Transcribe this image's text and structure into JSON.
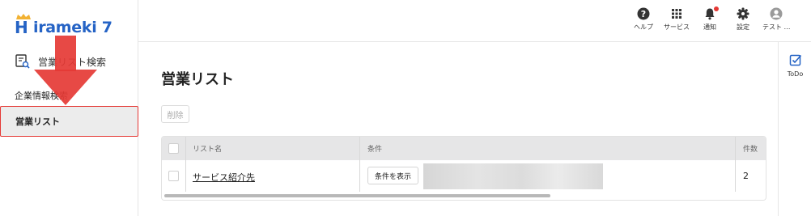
{
  "brand": {
    "logo_text": "irameki 7",
    "logo_letter": "H",
    "color": "#2563c5"
  },
  "sidebar": {
    "search_label": "営業リスト検索",
    "items": [
      {
        "label": "企業情報検索"
      },
      {
        "label": "営業リスト"
      }
    ]
  },
  "topbar": {
    "items": [
      {
        "label": "ヘルプ",
        "icon": "help-icon"
      },
      {
        "label": "サービス",
        "icon": "grid-icon"
      },
      {
        "label": "通知",
        "icon": "bell-icon"
      },
      {
        "label": "設定",
        "icon": "gear-icon"
      },
      {
        "label": "テスト …",
        "icon": "user-icon"
      }
    ]
  },
  "rail": {
    "todo_label": "ToDo"
  },
  "main": {
    "title": "営業リスト",
    "delete_label": "削除",
    "table": {
      "headers": [
        "リスト名",
        "条件",
        "件数"
      ],
      "rows": [
        {
          "name": "サービス紹介先",
          "condition_button": "条件を表示",
          "count": "2"
        }
      ]
    }
  },
  "colors": {
    "accent": "#2563c5",
    "alert": "#e53935",
    "header_bg": "#e6e6e7"
  }
}
